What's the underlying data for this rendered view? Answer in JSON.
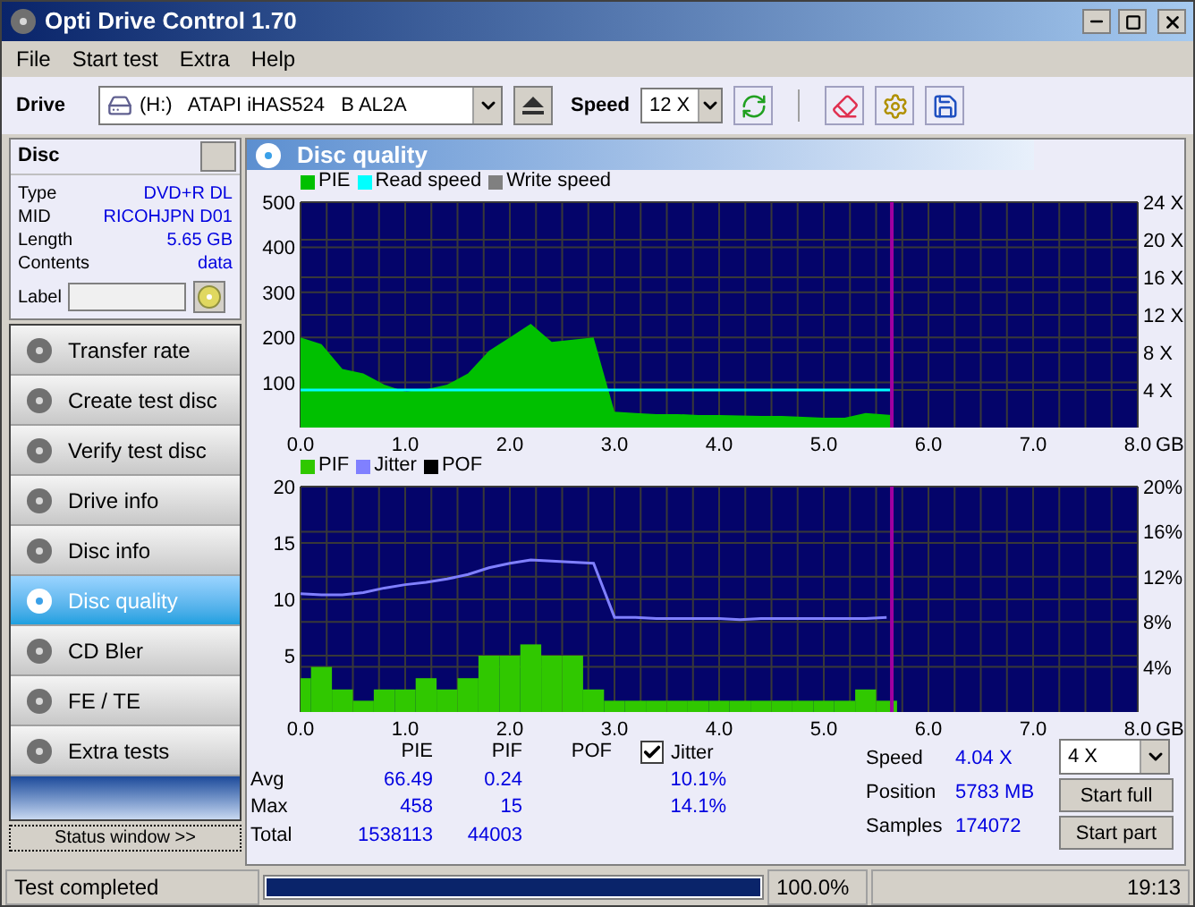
{
  "window": {
    "title": "Opti Drive Control 1.70"
  },
  "menu": [
    {
      "label": "File"
    },
    {
      "label": "Start test"
    },
    {
      "label": "Extra"
    },
    {
      "label": "Help"
    }
  ],
  "toolbar": {
    "drive_label": "Drive",
    "drive": "(H:)   ATAPI iHAS524   B AL2A",
    "speed_label": "Speed",
    "speed": "12 X"
  },
  "disc_panel": {
    "title": "Disc",
    "info": [
      {
        "label": "Type",
        "value": "DVD+R DL"
      },
      {
        "label": "MID",
        "value": "RICOHJPN D01"
      },
      {
        "label": "Length",
        "value": "5.65 GB"
      },
      {
        "label": "Contents",
        "value": "data"
      }
    ],
    "label_field": "Label"
  },
  "nav": [
    {
      "label": "Transfer rate",
      "selected": false
    },
    {
      "label": "Create test disc",
      "selected": false
    },
    {
      "label": "Verify test disc",
      "selected": false
    },
    {
      "label": "Drive info",
      "selected": false
    },
    {
      "label": "Disc info",
      "selected": false
    },
    {
      "label": "Disc quality",
      "selected": true
    },
    {
      "label": "CD Bler",
      "selected": false
    },
    {
      "label": "FE / TE",
      "selected": false
    },
    {
      "label": "Extra tests",
      "selected": false
    }
  ],
  "status_window_button": "Status window >>",
  "panel_title": "Disc quality",
  "pie_chart": {
    "chart_data": {
      "type": "area",
      "grid": true,
      "ref_lines": [
        {
          "axis": "x",
          "value": 5.65,
          "color": "#a000a0"
        }
      ],
      "xlabel": "GB",
      "xlim": [
        0,
        8
      ],
      "ylim": [
        0,
        500
      ],
      "y2lim": [
        0,
        24
      ],
      "yticks": [
        500,
        400,
        300,
        200,
        100
      ],
      "y2ticks": [
        {
          "value": 24,
          "label": "24 X"
        },
        {
          "value": 20,
          "label": "20 X"
        },
        {
          "value": 16,
          "label": "16 X"
        },
        {
          "value": 12,
          "label": "12 X"
        },
        {
          "value": 8,
          "label": "8 X"
        },
        {
          "value": 4,
          "label": "4 X"
        }
      ],
      "xticks": [
        {
          "value": 0,
          "label": "0.0"
        },
        {
          "value": 1,
          "label": "1.0"
        },
        {
          "value": 2,
          "label": "2.0"
        },
        {
          "value": 3,
          "label": "3.0"
        },
        {
          "value": 4,
          "label": "4.0"
        },
        {
          "value": 5,
          "label": "5.0"
        },
        {
          "value": 6,
          "label": "6.0"
        },
        {
          "value": 7,
          "label": "7.0"
        },
        {
          "value": 8,
          "label": "8.0"
        }
      ],
      "x": [
        0,
        0.2,
        0.4,
        0.6,
        0.8,
        1.0,
        1.2,
        1.4,
        1.6,
        1.8,
        2.0,
        2.2,
        2.4,
        2.6,
        2.8,
        3.0,
        3.2,
        3.4,
        3.6,
        3.8,
        4.0,
        4.2,
        4.4,
        4.6,
        4.8,
        5.0,
        5.2,
        5.4,
        5.65
      ],
      "series": [
        {
          "name": "PIE",
          "color": "#00c000",
          "values": [
            200,
            185,
            130,
            120,
            95,
            80,
            85,
            95,
            120,
            170,
            200,
            230,
            190,
            195,
            200,
            35,
            32,
            30,
            30,
            28,
            28,
            27,
            26,
            26,
            24,
            22,
            22,
            32,
            28
          ]
        },
        {
          "name": "Read speed",
          "color": "#00ffff",
          "axis": "y2",
          "type": "line",
          "values": [
            4,
            4,
            4,
            4,
            4,
            4,
            4,
            4,
            4,
            4,
            4,
            4,
            4,
            4,
            4,
            4,
            4,
            4,
            4,
            4,
            4,
            4,
            4,
            4,
            4,
            4,
            4,
            4,
            4
          ]
        },
        {
          "name": "Write speed",
          "color": "#808080",
          "values": [
            null,
            null,
            null,
            null,
            null,
            null,
            null,
            null,
            null,
            null,
            null,
            null,
            null,
            null,
            null,
            null,
            null,
            null,
            null,
            null,
            null,
            null,
            null,
            null,
            null,
            null,
            null,
            null,
            null
          ]
        }
      ]
    }
  },
  "pif_chart": {
    "chart_data": {
      "type": "bar",
      "grid": true,
      "ref_lines": [
        {
          "axis": "x",
          "value": 5.65,
          "color": "#a000a0"
        }
      ],
      "xlabel": "GB",
      "xlim": [
        0,
        8
      ],
      "ylim": [
        0,
        20
      ],
      "y2lim": [
        0,
        20
      ],
      "yticks": [
        20,
        15,
        10,
        5
      ],
      "y2ticks": [
        {
          "value": 20,
          "label": "20%"
        },
        {
          "value": 16,
          "label": "16%"
        },
        {
          "value": 12,
          "label": "12%"
        },
        {
          "value": 8,
          "label": "8%"
        },
        {
          "value": 4,
          "label": "4%"
        }
      ],
      "xticks": [
        {
          "value": 0,
          "label": "0.0"
        },
        {
          "value": 1,
          "label": "1.0"
        },
        {
          "value": 2,
          "label": "2.0"
        },
        {
          "value": 3,
          "label": "3.0"
        },
        {
          "value": 4,
          "label": "4.0"
        },
        {
          "value": 5,
          "label": "5.0"
        },
        {
          "value": 6,
          "label": "6.0"
        },
        {
          "value": 7,
          "label": "7.0"
        },
        {
          "value": 8,
          "label": "8.0"
        }
      ],
      "x": [
        0,
        0.2,
        0.4,
        0.6,
        0.8,
        1.0,
        1.2,
        1.4,
        1.6,
        1.8,
        2.0,
        2.2,
        2.4,
        2.6,
        2.8,
        3.0,
        3.2,
        3.4,
        3.6,
        3.8,
        4.0,
        4.2,
        4.4,
        4.6,
        4.8,
        5.0,
        5.2,
        5.4,
        5.6
      ],
      "series": [
        {
          "name": "PIF",
          "color": "#30c800",
          "values": [
            3,
            4,
            2,
            1,
            2,
            2,
            3,
            2,
            3,
            5,
            5,
            6,
            5,
            5,
            2,
            1,
            1,
            1,
            1,
            1,
            1,
            1,
            1,
            1,
            1,
            1,
            1,
            2,
            1
          ]
        },
        {
          "name": "Jitter",
          "color": "#8080ff",
          "type": "line",
          "values": [
            10.5,
            10.4,
            10.4,
            10.6,
            11.0,
            11.3,
            11.5,
            11.8,
            12.2,
            12.8,
            13.2,
            13.5,
            13.4,
            13.3,
            13.2,
            8.4,
            8.4,
            8.3,
            8.3,
            8.3,
            8.3,
            8.2,
            8.3,
            8.3,
            8.3,
            8.3,
            8.3,
            8.3,
            8.4
          ]
        },
        {
          "name": "POF",
          "color": "#000000",
          "values": [
            null,
            null,
            null,
            null,
            null,
            null,
            null,
            null,
            null,
            null,
            null,
            null,
            null,
            null,
            null,
            null,
            null,
            null,
            null,
            null,
            null,
            null,
            null,
            null,
            null,
            null,
            null,
            null,
            null
          ]
        }
      ]
    }
  },
  "results": {
    "columns": [
      "PIE",
      "PIF",
      "POF"
    ],
    "jitter": {
      "label": "Jitter",
      "checked": true
    },
    "rows": [
      {
        "label": "Avg",
        "pie": "66.49",
        "pif": "0.24",
        "jitter": "10.1%"
      },
      {
        "label": "Max",
        "pie": "458",
        "pif": "15",
        "jitter": "14.1%"
      },
      {
        "label": "Total",
        "pie": "1538113",
        "pif": "44003"
      }
    ]
  },
  "run": {
    "stats": [
      {
        "label": "Speed",
        "value": "4.04 X"
      },
      {
        "label": "Position",
        "value": "5783 MB"
      },
      {
        "label": "Samples",
        "value": "174072"
      }
    ],
    "test_speed": "4 X",
    "buttons": [
      "Start full",
      "Start part"
    ]
  },
  "status_bar": {
    "message": "Test completed",
    "progress": {
      "level": 1
    },
    "percent": "100.0%",
    "time": "19:13"
  }
}
